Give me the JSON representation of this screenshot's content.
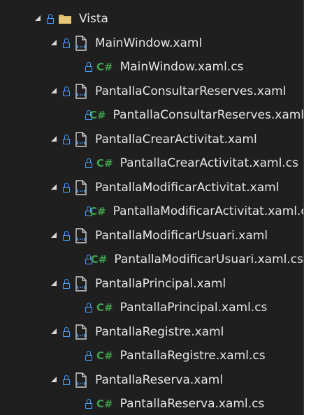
{
  "folder": {
    "name": "Vista",
    "icon": "folder-icon"
  },
  "items": [
    {
      "xaml": "MainWindow.xaml",
      "cs": "MainWindow.xaml.cs"
    },
    {
      "xaml": "PantallaConsultarReserves.xaml",
      "cs": "PantallaConsultarReserves.xaml.cs"
    },
    {
      "xaml": "PantallaCrearActivitat.xaml",
      "cs": "PantallaCrearActivitat.xaml.cs"
    },
    {
      "xaml": "PantallaModificarActivitat.xaml",
      "cs": "PantallaModificarActivitat.xaml.cs"
    },
    {
      "xaml": "PantallaModificarUsuari.xaml",
      "cs": "PantallaModificarUsuari.xaml.cs"
    },
    {
      "xaml": "PantallaPrincipal.xaml",
      "cs": "PantallaPrincipal.xaml.cs"
    },
    {
      "xaml": "PantallaRegistre.xaml",
      "cs": "PantallaRegistre.xaml.cs"
    },
    {
      "xaml": "PantallaReserva.xaml",
      "cs": "PantallaReserva.xaml.cs"
    }
  ],
  "cs_badge": "C#",
  "colors": {
    "background": "#1f1f1f",
    "text": "#e6e6e6",
    "lock": "#4ea3ff",
    "csharp": "#3ea24a",
    "folder": "#d9b86a"
  }
}
